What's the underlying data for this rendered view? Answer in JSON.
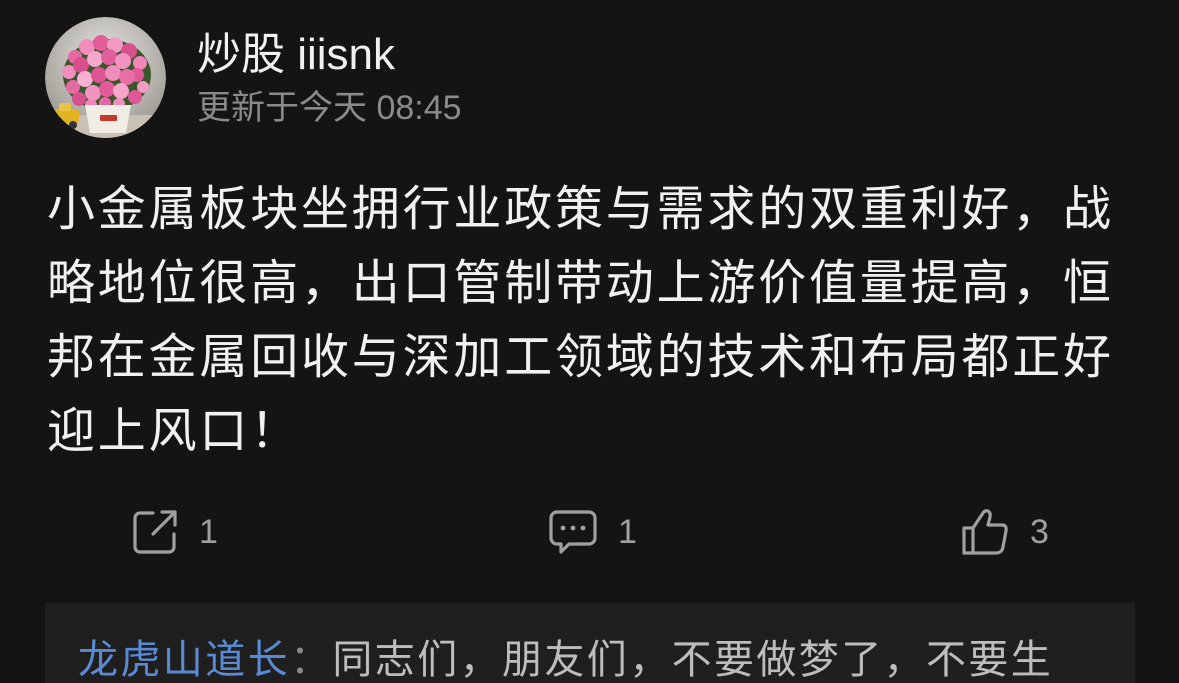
{
  "post": {
    "author": "炒股 iiisnk",
    "updated": "更新于今天 08:45",
    "content": "小金属板块坐拥行业政策与需求的双重利好，战略地位很高，出口管制带动上游价值量提高，恒邦在金属回收与深加工领域的技术和布局都正好迎上风口！"
  },
  "actions": {
    "share": {
      "icon": "share-icon",
      "count": "1"
    },
    "comment": {
      "icon": "comment-icon",
      "count": "1"
    },
    "like": {
      "icon": "thumbs-up-icon",
      "count": "3"
    }
  },
  "comment_preview": {
    "author": "龙虎山道长",
    "separator": "：",
    "text": "同志们，朋友们，不要做梦了，不要生"
  },
  "colors": {
    "bg": "#141414",
    "panel": "#1f1f1f",
    "text": "#f1f1f1",
    "muted": "#8a8a8a",
    "icon": "#a0a0a0",
    "link": "#5b8ad4",
    "comment_text": "#bdbdbd"
  }
}
